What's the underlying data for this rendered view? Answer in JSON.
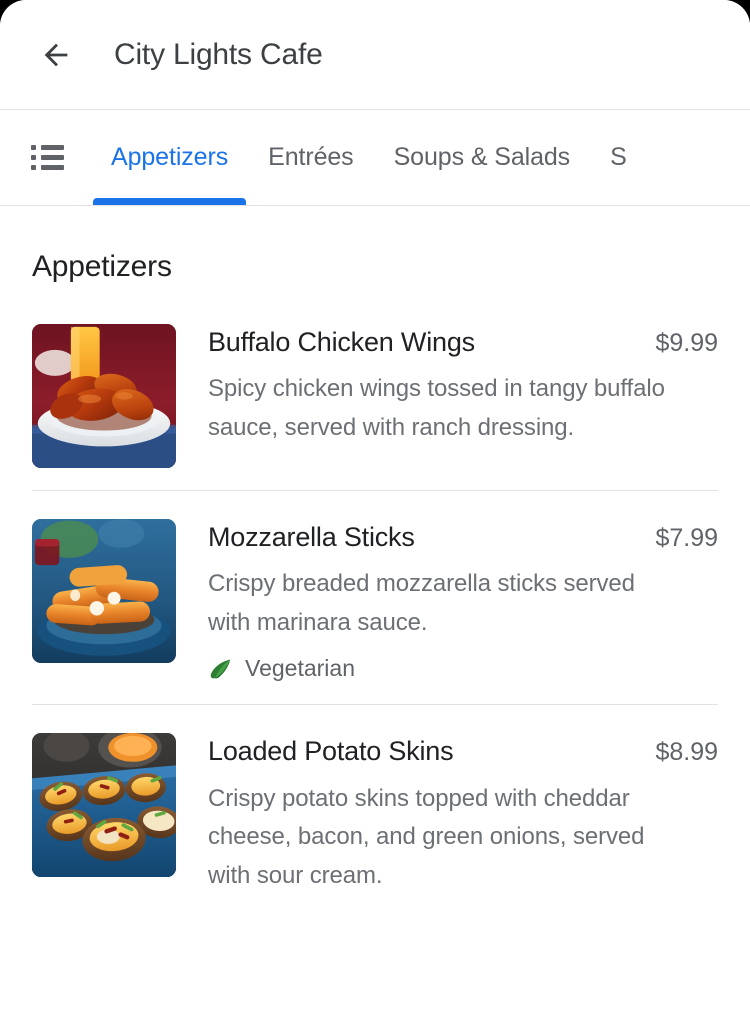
{
  "appbar": {
    "back_icon": "arrow-left-icon",
    "title": "City Lights Cafe"
  },
  "tabbar": {
    "list_icon": "list-view-icon",
    "active_tab": "Appetizers",
    "accent_color": "#1a73e8",
    "tabs": [
      {
        "label": "Appetizers",
        "active": true
      },
      {
        "label": "Entrées",
        "active": false
      },
      {
        "label": "Soups & Salads",
        "active": false
      },
      {
        "label": "S",
        "active": false
      }
    ]
  },
  "section": {
    "title": "Appetizers"
  },
  "menu_items": [
    {
      "name": "Buffalo Chicken Wings",
      "price": "$9.99",
      "description": "Spicy chicken wings tossed in tangy buffalo sauce, served with ranch dressing.",
      "image_alt": "buffalo-chicken-wings-photo",
      "tags": []
    },
    {
      "name": "Mozzarella Sticks",
      "price": "$7.99",
      "description": "Crispy breaded mozzarella sticks served with marinara sauce.",
      "image_alt": "mozzarella-sticks-photo",
      "tags": [
        {
          "label": "Vegetarian",
          "icon": "leaf-icon",
          "color": "#34a853"
        }
      ]
    },
    {
      "name": "Loaded Potato Skins",
      "price": "$8.99",
      "description": "Crispy potato skins topped with cheddar cheese, bacon, and green onions, served with sour cream.",
      "image_alt": "loaded-potato-skins-photo",
      "tags": []
    }
  ]
}
